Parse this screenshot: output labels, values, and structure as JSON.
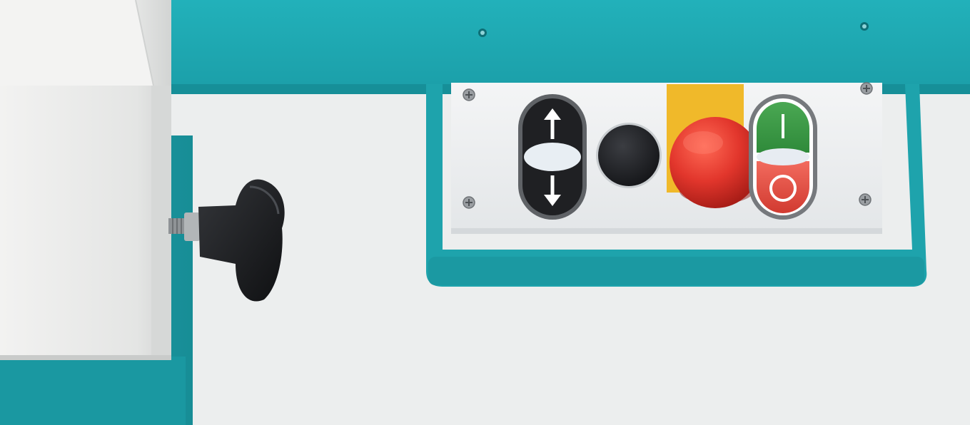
{
  "scene": {
    "colors": {
      "background": "#eceeee",
      "machine_teal": "#1fa9b3",
      "teal_dark": "#168a93",
      "housing_white": "#e6e7e6",
      "faceplate": "#eef0f1",
      "knob_black": "#1b1c1e",
      "stop_red": "#e2362c",
      "start_green": "#3a9a44",
      "guard_yellow": "#f0b92a"
    },
    "controls": {
      "jog_button": {
        "icons": [
          "arrow-up-icon",
          "arrow-down-icon"
        ]
      },
      "black_button": {},
      "emergency_stop": {},
      "start_stop_button": {
        "icons": [
          "start-line-icon",
          "stop-circle-icon"
        ]
      }
    },
    "clamp_knob": {}
  }
}
